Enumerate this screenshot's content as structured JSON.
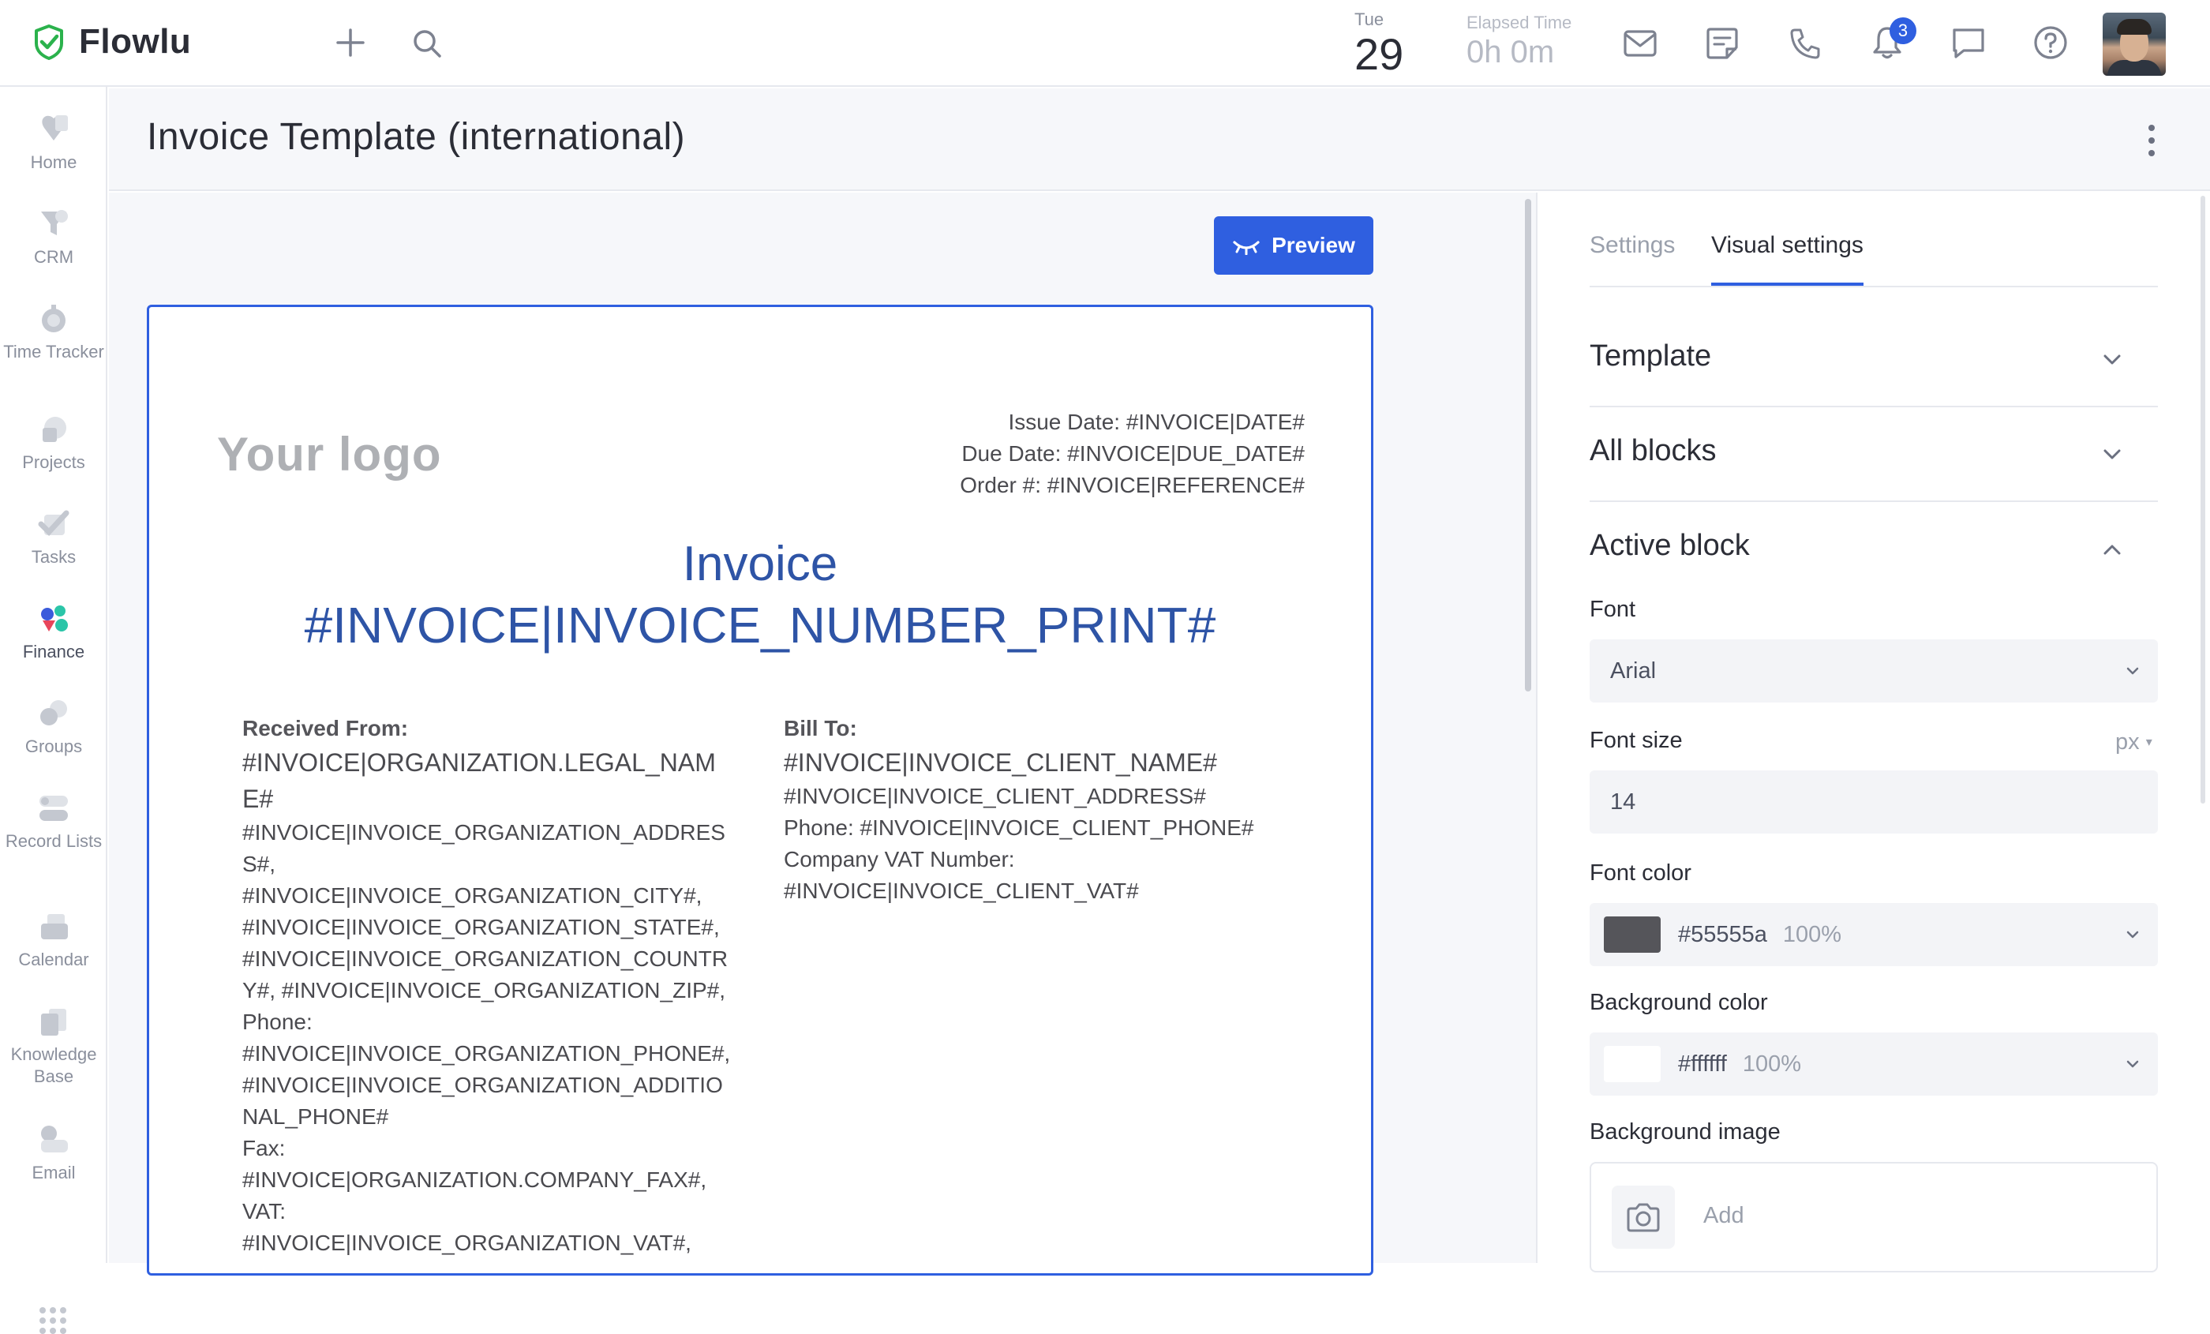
{
  "app": {
    "brand_name": "Flowlu",
    "brand_color": "#2bb24c",
    "accent_color": "#2f5fe0"
  },
  "topbar": {
    "day_name": "Tue",
    "day_number": "29",
    "elapsed_label": "Elapsed Time",
    "elapsed_value": "0h 0m",
    "notification_count": "3",
    "icons": [
      "plus-icon",
      "search-icon",
      "mail-icon",
      "notes-icon",
      "phone-icon",
      "bell-icon",
      "chat-icon",
      "help-icon"
    ]
  },
  "sidebar": {
    "items": [
      {
        "label": "Home",
        "icon": "home-icon"
      },
      {
        "label": "CRM",
        "icon": "crm-icon"
      },
      {
        "label": "Time Tracker",
        "icon": "time-tracker-icon"
      },
      {
        "label": "Projects",
        "icon": "projects-icon"
      },
      {
        "label": "Tasks",
        "icon": "tasks-icon"
      },
      {
        "label": "Finance",
        "icon": "finance-icon",
        "active": true
      },
      {
        "label": "Groups",
        "icon": "groups-icon"
      },
      {
        "label": "Record Lists",
        "icon": "record-lists-icon"
      },
      {
        "label": "Calendar",
        "icon": "calendar-icon"
      },
      {
        "label": "Knowledge Base",
        "icon": "knowledge-base-icon"
      },
      {
        "label": "Email",
        "icon": "email-icon"
      }
    ]
  },
  "page": {
    "title": "Invoice Template (international)"
  },
  "canvas": {
    "preview_label": "Preview"
  },
  "document": {
    "logo_text": "Your logo",
    "issue_date": "Issue Date: #INVOICE|DATE#",
    "due_date": "Due Date: #INVOICE|DUE_DATE#",
    "order_number": "Order #: #INVOICE|REFERENCE#",
    "title_line1": "Invoice",
    "title_line2": "#INVOICE|INVOICE_NUMBER_PRINT#",
    "received_from": {
      "heading": "Received From:",
      "name": "#INVOICE|ORGANIZATION.LEGAL_NAME#",
      "address": "#INVOICE|INVOICE_ORGANIZATION_ADDRESS#,",
      "city": "#INVOICE|INVOICE_ORGANIZATION_CITY#,",
      "state": "#INVOICE|INVOICE_ORGANIZATION_STATE#,",
      "country_zip": "#INVOICE|INVOICE_ORGANIZATION_COUNTRY#, #INVOICE|INVOICE_ORGANIZATION_ZIP#,",
      "phone_label": "Phone:",
      "phone": "#INVOICE|INVOICE_ORGANIZATION_PHONE#,",
      "additional_phone": "#INVOICE|INVOICE_ORGANIZATION_ADDITIONAL_PHONE#",
      "fax_label": "Fax:",
      "fax": "#INVOICE|ORGANIZATION.COMPANY_FAX#,",
      "vat_label": "VAT:",
      "vat": "#INVOICE|INVOICE_ORGANIZATION_VAT#,"
    },
    "bill_to": {
      "heading": "Bill To:",
      "client_name": "#INVOICE|INVOICE_CLIENT_NAME#",
      "client_address": "#INVOICE|INVOICE_CLIENT_ADDRESS#",
      "client_phone": "Phone: #INVOICE|INVOICE_CLIENT_PHONE#",
      "vat_label": "Company VAT Number:",
      "client_vat": "#INVOICE|INVOICE_CLIENT_VAT#"
    }
  },
  "panel": {
    "tabs": [
      {
        "label": "Settings",
        "active": false
      },
      {
        "label": "Visual settings",
        "active": true
      }
    ],
    "sections": [
      {
        "title": "Template",
        "expanded": false
      },
      {
        "title": "All blocks",
        "expanded": false
      },
      {
        "title": "Active block",
        "expanded": true
      }
    ],
    "font": {
      "label": "Font",
      "value": "Arial"
    },
    "font_size": {
      "label": "Font size",
      "unit": "px",
      "value": "14"
    },
    "font_color": {
      "label": "Font color",
      "hex": "#55555a",
      "opacity": "100%"
    },
    "background_color": {
      "label": "Background color",
      "hex": "#ffffff",
      "opacity": "100%"
    },
    "background_image": {
      "label": "Background image",
      "add_label": "Add"
    }
  }
}
